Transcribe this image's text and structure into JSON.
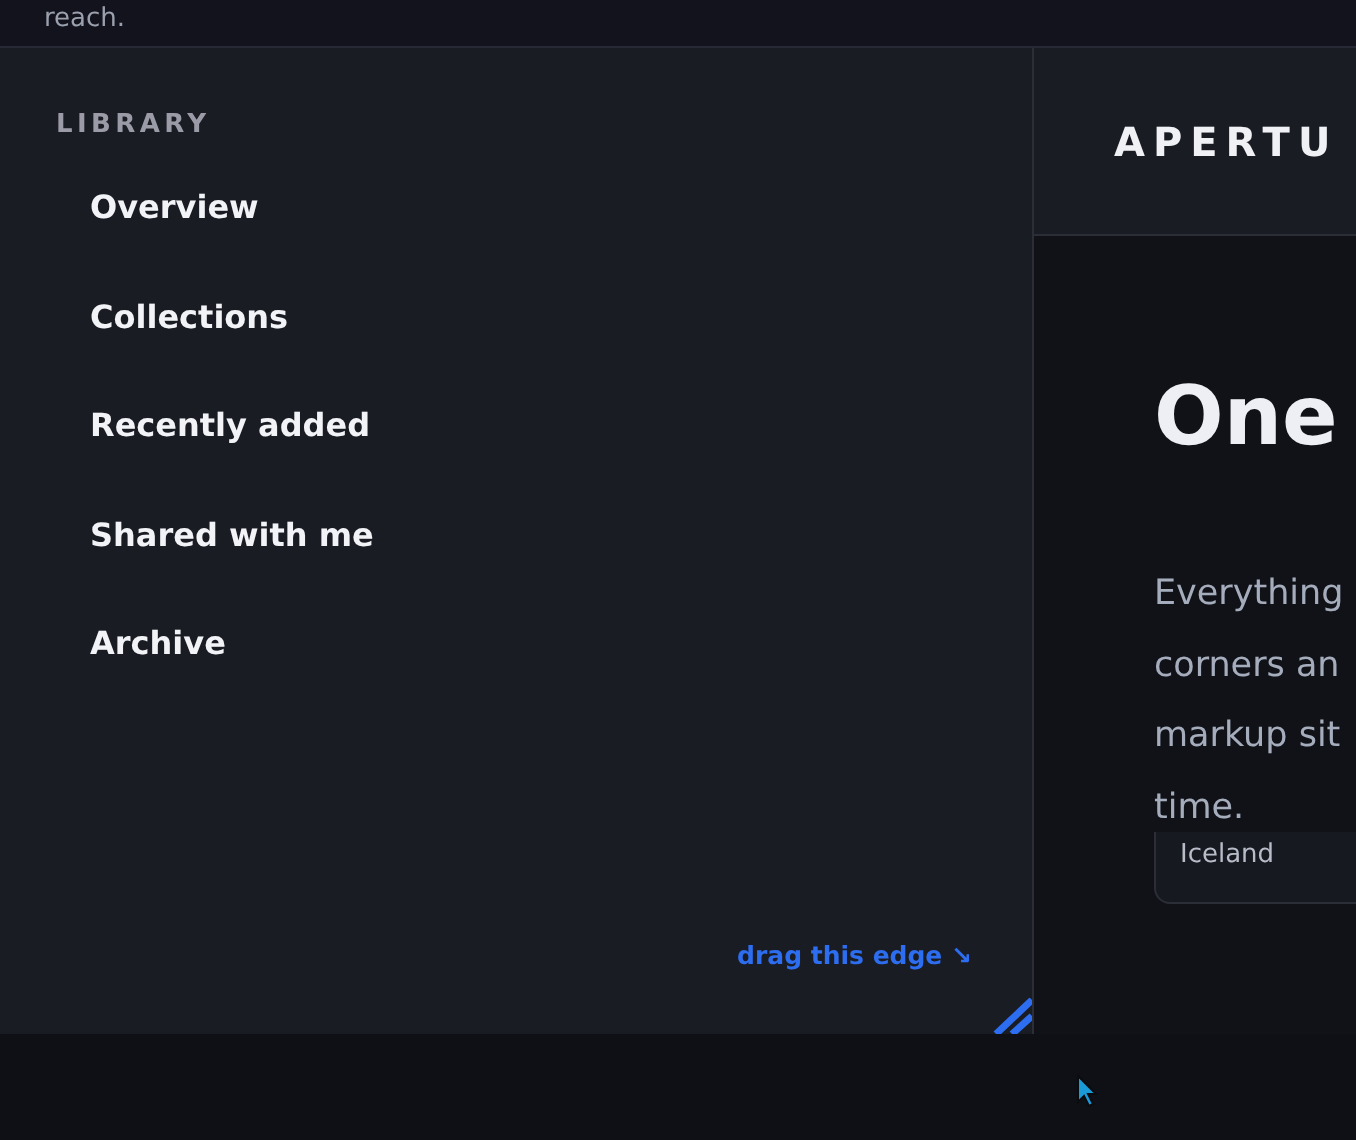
{
  "top_strip": {
    "text": "reach."
  },
  "sidebar": {
    "heading": "LIBRARY",
    "items": [
      {
        "label": "Overview"
      },
      {
        "label": "Collections"
      },
      {
        "label": "Recently added"
      },
      {
        "label": "Shared with me"
      },
      {
        "label": "Archive"
      }
    ],
    "hint": "drag this edge ↘"
  },
  "main": {
    "brand": "APERTU",
    "headline": "One",
    "paragraph_lines": [
      "Everything",
      "corners an",
      "markup sit",
      "time."
    ],
    "card": {
      "text": "Iceland"
    }
  }
}
